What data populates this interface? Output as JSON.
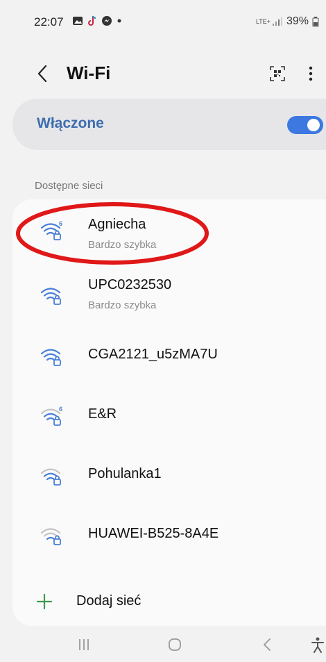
{
  "status_bar": {
    "time": "22:07",
    "network_type": "LTE+",
    "battery": "39%"
  },
  "header": {
    "title": "Wi-Fi"
  },
  "wifi_toggle": {
    "label": "Włączone",
    "enabled": true
  },
  "section": {
    "available_label": "Dostępne sieci"
  },
  "networks": [
    {
      "name": "Agniecha",
      "subtitle": "Bardzo szybka",
      "wifi6": true,
      "signal": 3
    },
    {
      "name": "UPC0232530",
      "subtitle": "Bardzo szybka",
      "wifi6": false,
      "signal": 3
    },
    {
      "name": "CGA2121_u5zMA7U",
      "subtitle": "",
      "wifi6": false,
      "signal": 3
    },
    {
      "name": "E&R",
      "subtitle": "",
      "wifi6": true,
      "signal": 2
    },
    {
      "name": "Pohulanka1",
      "subtitle": "",
      "wifi6": false,
      "signal": 2
    },
    {
      "name": "HUAWEI-B525-8A4E",
      "subtitle": "",
      "wifi6": false,
      "signal": 1
    }
  ],
  "add_network": {
    "label": "Dodaj sieć"
  },
  "colors": {
    "accent": "#3c78e0",
    "toggle_label": "#3e6db0",
    "wifi_strong": "#4a7fd6",
    "wifi_weak": "#b8b8b8",
    "add_plus": "#3a9a4a",
    "highlight": "#e01818"
  }
}
